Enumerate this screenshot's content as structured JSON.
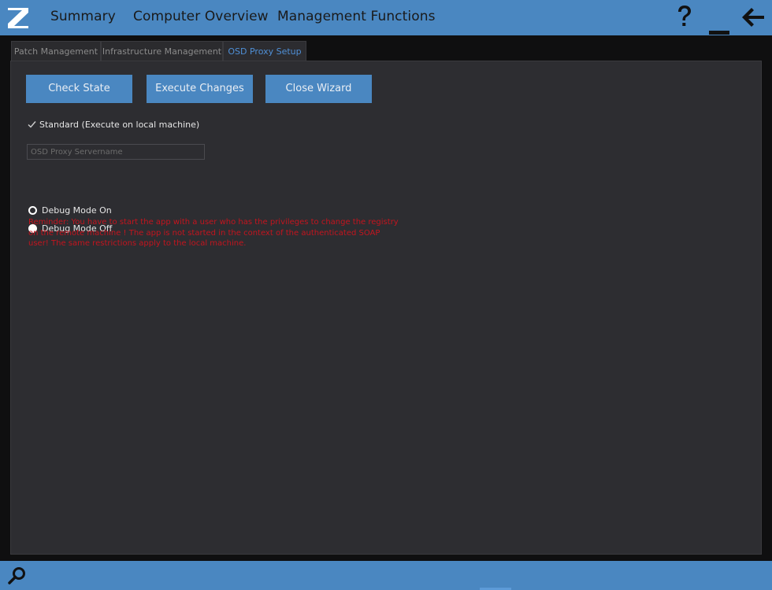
{
  "header": {
    "nav": [
      {
        "label": "Summary"
      },
      {
        "label": "Computer Overview"
      },
      {
        "label": "Management Functions"
      }
    ]
  },
  "tabs": [
    {
      "label": "Patch Management",
      "active": false
    },
    {
      "label": "Infrastructure Management",
      "active": false
    },
    {
      "label": "OSD Proxy Setup",
      "active": true
    }
  ],
  "buttons": {
    "check_state": "Check State",
    "execute_changes": "Execute Changes",
    "close_wizard": "Close Wizard"
  },
  "standard_checkbox": {
    "label": "Standard (Execute on local machine)",
    "checked": true
  },
  "servername_field": {
    "value": "",
    "placeholder": "OSD Proxy Servername"
  },
  "debug_mode": {
    "options": [
      {
        "label": "Debug Mode On",
        "selected": false
      },
      {
        "label": "Debug Mode Off",
        "selected": true
      }
    ]
  },
  "reminder": "Reminder: You have to start the app with a user who has the privileges to change the registry on the remote machine ! The app is not started in the context of the authenticated SOAP user!  The same restrictions apply to the local machine.",
  "colors": {
    "accent": "#4a87c1",
    "active_tab_text": "#4f8fd6",
    "warning_text": "#c4141e",
    "panel_bg": "#2d2d31"
  },
  "icons": {
    "logo": "app-logo-icon",
    "help": "question-mark-icon",
    "minimize": "minimize-icon",
    "back": "back-arrow-icon",
    "search": "search-icon"
  }
}
